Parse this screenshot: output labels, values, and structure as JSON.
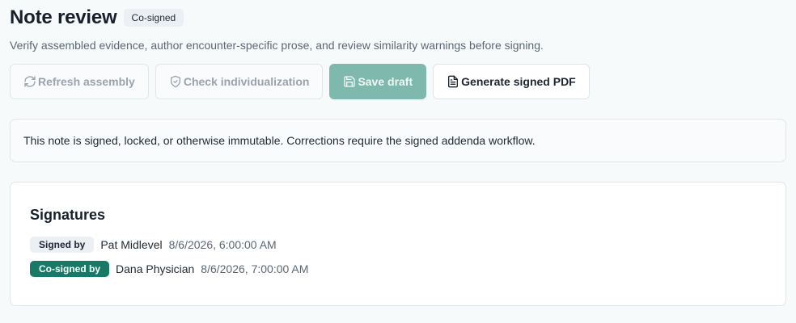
{
  "header": {
    "title": "Note review",
    "status_badge": "Co-signed",
    "subtitle": "Verify assembled evidence, author encounter-specific prose, and review similarity warnings before signing."
  },
  "toolbar": {
    "refresh_label": "Refresh assembly",
    "individualization_label": "Check individualization",
    "save_label": "Save draft",
    "pdf_label": "Generate signed PDF"
  },
  "notice": {
    "text": "This note is signed, locked, or otherwise immutable. Corrections require the signed addenda workflow."
  },
  "signatures": {
    "title": "Signatures",
    "rows": [
      {
        "role": "Signed by",
        "name": "Pat Midlevel",
        "time": "8/6/2026, 6:00:00 AM"
      },
      {
        "role": "Co-signed by",
        "name": "Dana Physician",
        "time": "8/6/2026, 7:00:00 AM"
      }
    ]
  },
  "colors": {
    "primary": "#7fb8ac",
    "cosign_badge": "#177a67",
    "muted_text": "#5b6775"
  },
  "icons": {
    "refresh": "refresh-icon",
    "individualization": "shield-check-icon",
    "save": "save-icon",
    "pdf": "file-text-icon"
  }
}
